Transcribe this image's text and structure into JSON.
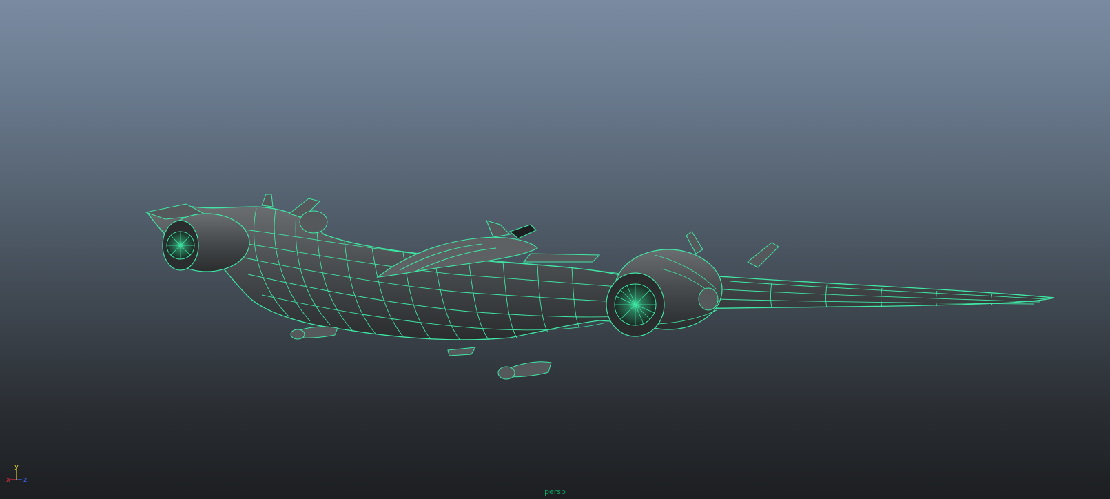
{
  "viewport": {
    "camera": "persp",
    "model": "aircraft-wireframe-on-shaded",
    "wireframe_color": "#3fe6a4",
    "mesh_color": "#4a4d4f"
  },
  "axis_gizmo": {
    "x_label": "x",
    "y_label": "y",
    "z_label": "z",
    "x_color": "#e0303a",
    "y_color": "#d8d030",
    "z_color": "#4060f0"
  }
}
